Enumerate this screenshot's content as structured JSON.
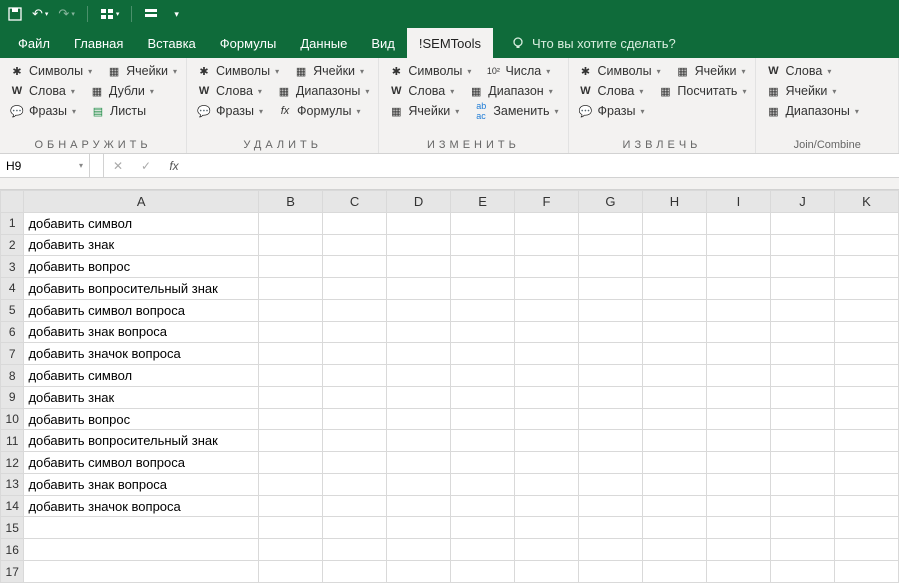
{
  "titlebar": {
    "save": "💾",
    "undo": "↶",
    "redo": "↷"
  },
  "tabs": {
    "file": "Файл",
    "home": "Главная",
    "insert": "Вставка",
    "formulas": "Формулы",
    "data": "Данные",
    "view": "Вид",
    "semtools": "!SEMTools",
    "tellme": "Что вы хотите сделать?"
  },
  "ribbon": {
    "g1": {
      "symbols": "Символы",
      "cells": "Ячейки",
      "words": "Слова",
      "dupes": "Дубли",
      "phrases": "Фразы",
      "sheets": "Листы",
      "label": "ОБНАРУЖИТЬ"
    },
    "g2": {
      "symbols": "Символы",
      "cells": "Ячейки",
      "words": "Слова",
      "ranges": "Диапазоны",
      "phrases": "Фразы",
      "formulas": "Формулы",
      "label": "УДАЛИТЬ"
    },
    "g3": {
      "symbols": "Символы",
      "numbers": "Числа",
      "words": "Слова",
      "range": "Диапазон",
      "cells": "Ячейки",
      "replace": "Заменить",
      "label": "ИЗМЕНИТЬ"
    },
    "g4": {
      "symbols": "Символы",
      "cells": "Ячейки",
      "words": "Слова",
      "count": "Посчитать",
      "phrases": "Фразы",
      "label": "ИЗВЛЕЧЬ"
    },
    "g5": {
      "words": "Слова",
      "cells": "Ячейки",
      "ranges": "Диапазоны",
      "label": "Join/Combine"
    }
  },
  "namebox": {
    "ref": "H9"
  },
  "formula": {
    "value": ""
  },
  "columns": [
    "A",
    "B",
    "C",
    "D",
    "E",
    "F",
    "G",
    "H",
    "I",
    "J",
    "K"
  ],
  "rows": [
    {
      "n": 1,
      "a": "добавить символ"
    },
    {
      "n": 2,
      "a": "добавить знак"
    },
    {
      "n": 3,
      "a": "добавить вопрос"
    },
    {
      "n": 4,
      "a": "добавить вопросительный знак"
    },
    {
      "n": 5,
      "a": "добавить символ вопроса"
    },
    {
      "n": 6,
      "a": "добавить знак вопроса"
    },
    {
      "n": 7,
      "a": "добавить значок вопроса"
    },
    {
      "n": 8,
      "a": "добавить символ"
    },
    {
      "n": 9,
      "a": "добавить знак"
    },
    {
      "n": 10,
      "a": "добавить вопрос"
    },
    {
      "n": 11,
      "a": "добавить вопросительный знак"
    },
    {
      "n": 12,
      "a": "добавить символ вопроса"
    },
    {
      "n": 13,
      "a": "добавить знак вопроса"
    },
    {
      "n": 14,
      "a": "добавить значок вопроса"
    },
    {
      "n": 15,
      "a": ""
    },
    {
      "n": 16,
      "a": ""
    },
    {
      "n": 17,
      "a": ""
    }
  ]
}
